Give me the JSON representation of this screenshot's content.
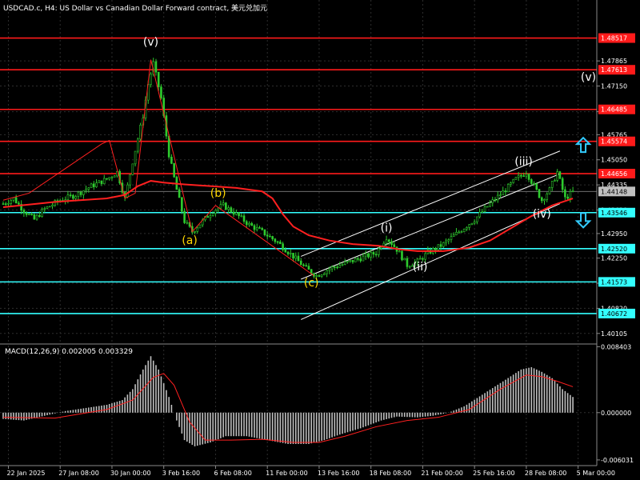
{
  "window": {
    "title": "USDCAD.c, H4:  US Dollar vs Canadian Dollar Forward contract, 美元兑加元"
  },
  "colors": {
    "background": "#000000",
    "grid": "#2e2e2e",
    "axis": "#8a8a8a",
    "text": "#ffffff",
    "candle": "#2ecc2e",
    "ma": "#ff2020",
    "resistance": "#ff1a1a",
    "support": "#33ffff",
    "channel": "#ffffff",
    "wave_label_yellow": "#ffd700",
    "wave_label_white": "#ffffff",
    "macd_hist": "#c0c0c0",
    "macd_signal": "#ff2020",
    "arrow": "#33ccff",
    "current_price_bg": "#c0c0c0"
  },
  "chart_data": {
    "type": "candlestick",
    "title": "USDCAD.c, H4:  US Dollar vs Canadian Dollar Forward contract, 美元兑加元",
    "price_axis": {
      "range": [
        1.3985,
        1.496
      ],
      "ticks": [
        "1.47865",
        "1.47150",
        "1.46420",
        "1.45765",
        "1.45050",
        "1.44335",
        "1.43620",
        "1.42950",
        "1.42250",
        "1.41535",
        "1.40820",
        "1.40105"
      ]
    },
    "time_axis": {
      "labels": [
        "22 Jan 2025",
        "27 Jan 08:00",
        "30 Jan 00:00",
        "3 Feb 16:00",
        "6 Feb 08:00",
        "11 Feb 00:00",
        "13 Feb 16:00",
        "18 Feb 08:00",
        "21 Feb 00:00",
        "25 Feb 16:00",
        "28 Feb 08:00",
        "5 Mar 00:00"
      ]
    },
    "price_path": [
      {
        "t": 0,
        "p": 1.438
      },
      {
        "t": 4,
        "p": 1.4395
      },
      {
        "t": 8,
        "p": 1.436
      },
      {
        "t": 12,
        "p": 1.4335
      },
      {
        "t": 16,
        "p": 1.4365
      },
      {
        "t": 22,
        "p": 1.439
      },
      {
        "t": 28,
        "p": 1.4405
      },
      {
        "t": 34,
        "p": 1.443
      },
      {
        "t": 40,
        "p": 1.445
      },
      {
        "t": 44,
        "p": 1.447
      },
      {
        "t": 47,
        "p": 1.4395
      },
      {
        "t": 50,
        "p": 1.45
      },
      {
        "t": 54,
        "p": 1.463
      },
      {
        "t": 56,
        "p": 1.472
      },
      {
        "t": 58,
        "p": 1.478
      },
      {
        "t": 61,
        "p": 1.468
      },
      {
        "t": 64,
        "p": 1.452
      },
      {
        "t": 67,
        "p": 1.442
      },
      {
        "t": 70,
        "p": 1.433
      },
      {
        "t": 73,
        "p": 1.43
      },
      {
        "t": 77,
        "p": 1.433
      },
      {
        "t": 81,
        "p": 1.436
      },
      {
        "t": 85,
        "p": 1.4375
      },
      {
        "t": 90,
        "p": 1.435
      },
      {
        "t": 95,
        "p": 1.432
      },
      {
        "t": 100,
        "p": 1.43
      },
      {
        "t": 106,
        "p": 1.427
      },
      {
        "t": 112,
        "p": 1.423
      },
      {
        "t": 117,
        "p": 1.4195
      },
      {
        "t": 121,
        "p": 1.4175
      },
      {
        "t": 126,
        "p": 1.4195
      },
      {
        "t": 132,
        "p": 1.421
      },
      {
        "t": 138,
        "p": 1.4225
      },
      {
        "t": 144,
        "p": 1.424
      },
      {
        "t": 148,
        "p": 1.4285
      },
      {
        "t": 152,
        "p": 1.425
      },
      {
        "t": 156,
        "p": 1.4205
      },
      {
        "t": 160,
        "p": 1.4215
      },
      {
        "t": 164,
        "p": 1.424
      },
      {
        "t": 170,
        "p": 1.4265
      },
      {
        "t": 176,
        "p": 1.43
      },
      {
        "t": 182,
        "p": 1.4335
      },
      {
        "t": 188,
        "p": 1.438
      },
      {
        "t": 194,
        "p": 1.442
      },
      {
        "t": 198,
        "p": 1.445
      },
      {
        "t": 202,
        "p": 1.447
      },
      {
        "t": 205,
        "p": 1.443
      },
      {
        "t": 208,
        "p": 1.439
      },
      {
        "t": 211,
        "p": 1.442
      },
      {
        "t": 214,
        "p": 1.447
      },
      {
        "t": 217,
        "p": 1.4395
      },
      {
        "t": 220,
        "p": 1.4414
      }
    ],
    "moving_average": [
      {
        "t": 0,
        "p": 1.437
      },
      {
        "t": 20,
        "p": 1.4385
      },
      {
        "t": 40,
        "p": 1.4395
      },
      {
        "t": 47,
        "p": 1.4405
      },
      {
        "t": 52,
        "p": 1.443
      },
      {
        "t": 57,
        "p": 1.4445
      },
      {
        "t": 62,
        "p": 1.444
      },
      {
        "t": 70,
        "p": 1.4435
      },
      {
        "t": 80,
        "p": 1.443
      },
      {
        "t": 90,
        "p": 1.4425
      },
      {
        "t": 100,
        "p": 1.4415
      },
      {
        "t": 104,
        "p": 1.4395
      },
      {
        "t": 108,
        "p": 1.435
      },
      {
        "t": 112,
        "p": 1.4315
      },
      {
        "t": 118,
        "p": 1.429
      },
      {
        "t": 126,
        "p": 1.4275
      },
      {
        "t": 135,
        "p": 1.4265
      },
      {
        "t": 145,
        "p": 1.426
      },
      {
        "t": 153,
        "p": 1.425
      },
      {
        "t": 160,
        "p": 1.4245
      },
      {
        "t": 170,
        "p": 1.4245
      },
      {
        "t": 180,
        "p": 1.4255
      },
      {
        "t": 188,
        "p": 1.4275
      },
      {
        "t": 196,
        "p": 1.431
      },
      {
        "t": 204,
        "p": 1.4345
      },
      {
        "t": 212,
        "p": 1.4375
      },
      {
        "t": 220,
        "p": 1.4395
      }
    ],
    "horizontal_levels": [
      {
        "value": 1.48517,
        "label": "1.48517",
        "kind": "resistance"
      },
      {
        "value": 1.47613,
        "label": "1.47613",
        "kind": "resistance"
      },
      {
        "value": 1.46485,
        "label": "1.46485",
        "kind": "resistance"
      },
      {
        "value": 1.45574,
        "label": "1.45574",
        "kind": "resistance"
      },
      {
        "value": 1.44656,
        "label": "1.44656",
        "kind": "resistance"
      },
      {
        "value": 1.44148,
        "label": "1.44148",
        "kind": "current"
      },
      {
        "value": 1.43546,
        "label": "1.43546",
        "kind": "support"
      },
      {
        "value": 1.4252,
        "label": "1.42520",
        "kind": "support"
      },
      {
        "value": 1.41573,
        "label": "1.41573",
        "kind": "support"
      },
      {
        "value": 1.40672,
        "label": "1.40672",
        "kind": "support"
      }
    ],
    "channel": {
      "lines": [
        {
          "t1": 115,
          "p1": 1.423,
          "t2": 215,
          "p2": 1.453
        },
        {
          "t1": 115,
          "p1": 1.4165,
          "t2": 215,
          "p2": 1.4465
        },
        {
          "t1": 115,
          "p1": 1.405,
          "t2": 215,
          "p2": 1.438
        }
      ]
    },
    "wave_lines": [
      [
        {
          "t": 0,
          "p": 1.439
        },
        {
          "t": 10,
          "p": 1.441
        },
        {
          "t": 38,
          "p": 1.455
        },
        {
          "t": 41,
          "p": 1.456
        },
        {
          "t": 47,
          "p": 1.4395
        },
        {
          "t": 51,
          "p": 1.441
        },
        {
          "t": 57,
          "p": 1.479
        },
        {
          "t": 73,
          "p": 1.43
        },
        {
          "t": 82,
          "p": 1.4375
        },
        {
          "t": 120,
          "p": 1.4175
        }
      ]
    ],
    "wave_labels": [
      {
        "text": "(v)",
        "t": 57,
        "p": 1.483,
        "color": "white"
      },
      {
        "text": "(a)",
        "t": 72,
        "p": 1.4265,
        "color": "yellow"
      },
      {
        "text": "(b)",
        "t": 83,
        "p": 1.44,
        "color": "yellow"
      },
      {
        "text": "(c)",
        "t": 119,
        "p": 1.4145,
        "color": "yellow"
      },
      {
        "text": "(i)",
        "t": 148,
        "p": 1.43,
        "color": "white"
      },
      {
        "text": "(ii)",
        "t": 161,
        "p": 1.419,
        "color": "white"
      },
      {
        "text": "(iii)",
        "t": 201,
        "p": 1.449,
        "color": "white"
      },
      {
        "text": "(iv)",
        "t": 208,
        "p": 1.434,
        "color": "white"
      },
      {
        "text": "(v)",
        "t": 226,
        "p": 1.473,
        "color": "white"
      }
    ],
    "arrows": [
      {
        "direction": "up",
        "t": 224,
        "p": 1.4545
      },
      {
        "direction": "down",
        "t": 224,
        "p": 1.4335
      }
    ],
    "macd": {
      "label": "MACD(12,26,9) 0.002005 0.003329",
      "range": [
        -0.00655,
        0.00855
      ],
      "ticks": [
        "0.008403",
        "0.000000",
        "-0.006031"
      ],
      "histogram": [
        {
          "t": 0,
          "v": -0.0008
        },
        {
          "t": 8,
          "v": -0.001
        },
        {
          "t": 16,
          "v": -0.0004
        },
        {
          "t": 24,
          "v": 0.0002
        },
        {
          "t": 32,
          "v": 0.0006
        },
        {
          "t": 40,
          "v": 0.001
        },
        {
          "t": 46,
          "v": 0.0016
        },
        {
          "t": 50,
          "v": 0.003
        },
        {
          "t": 54,
          "v": 0.0055
        },
        {
          "t": 57,
          "v": 0.0072
        },
        {
          "t": 60,
          "v": 0.0055
        },
        {
          "t": 64,
          "v": 0.002
        },
        {
          "t": 67,
          "v": -0.001
        },
        {
          "t": 70,
          "v": -0.0035
        },
        {
          "t": 74,
          "v": -0.0043
        },
        {
          "t": 80,
          "v": -0.0038
        },
        {
          "t": 86,
          "v": -0.003
        },
        {
          "t": 94,
          "v": -0.003
        },
        {
          "t": 102,
          "v": -0.0035
        },
        {
          "t": 110,
          "v": -0.004
        },
        {
          "t": 118,
          "v": -0.004
        },
        {
          "t": 124,
          "v": -0.0035
        },
        {
          "t": 130,
          "v": -0.0028
        },
        {
          "t": 138,
          "v": -0.002
        },
        {
          "t": 146,
          "v": -0.001
        },
        {
          "t": 152,
          "v": -0.0005
        },
        {
          "t": 160,
          "v": -0.0006
        },
        {
          "t": 166,
          "v": -0.0004
        },
        {
          "t": 172,
          "v": 0.0
        },
        {
          "t": 178,
          "v": 0.0008
        },
        {
          "t": 186,
          "v": 0.0025
        },
        {
          "t": 194,
          "v": 0.0042
        },
        {
          "t": 200,
          "v": 0.0055
        },
        {
          "t": 204,
          "v": 0.0058
        },
        {
          "t": 208,
          "v": 0.0052
        },
        {
          "t": 212,
          "v": 0.0044
        },
        {
          "t": 216,
          "v": 0.003
        },
        {
          "t": 220,
          "v": 0.002
        }
      ],
      "signal": [
        {
          "t": 0,
          "v": -0.0006
        },
        {
          "t": 20,
          "v": -0.0007
        },
        {
          "t": 40,
          "v": 0.0004
        },
        {
          "t": 50,
          "v": 0.0016
        },
        {
          "t": 58,
          "v": 0.0045
        },
        {
          "t": 62,
          "v": 0.005
        },
        {
          "t": 66,
          "v": 0.0035
        },
        {
          "t": 72,
          "v": -0.0012
        },
        {
          "t": 78,
          "v": -0.0035
        },
        {
          "t": 88,
          "v": -0.0035
        },
        {
          "t": 100,
          "v": -0.0034
        },
        {
          "t": 112,
          "v": -0.0038
        },
        {
          "t": 122,
          "v": -0.0038
        },
        {
          "t": 132,
          "v": -0.003
        },
        {
          "t": 144,
          "v": -0.0018
        },
        {
          "t": 156,
          "v": -0.001
        },
        {
          "t": 168,
          "v": -0.0006
        },
        {
          "t": 180,
          "v": 0.0004
        },
        {
          "t": 192,
          "v": 0.003
        },
        {
          "t": 202,
          "v": 0.0048
        },
        {
          "t": 208,
          "v": 0.0046
        },
        {
          "t": 214,
          "v": 0.004
        },
        {
          "t": 220,
          "v": 0.0033
        }
      ]
    }
  }
}
